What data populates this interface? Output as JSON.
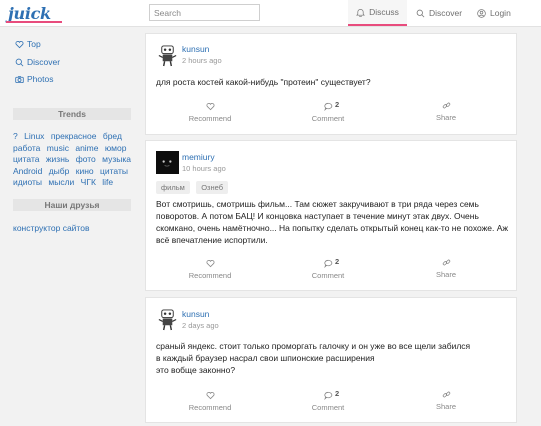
{
  "header": {
    "logo": "juick",
    "search_placeholder": "Search",
    "nav": [
      {
        "label": "Discuss",
        "icon": "bell-icon"
      },
      {
        "label": "Discover",
        "icon": "search-icon"
      },
      {
        "label": "Login",
        "icon": "user-icon"
      }
    ]
  },
  "sidebar": {
    "links": [
      {
        "label": "Top",
        "icon": "heart-icon"
      },
      {
        "label": "Discover",
        "icon": "search-icon"
      },
      {
        "label": "Photos",
        "icon": "camera-icon"
      }
    ],
    "trends_title": "Trends",
    "tags": [
      "?",
      "Linux",
      "прекрасное",
      "бред",
      "работа",
      "music",
      "anime",
      "юмор",
      "цитата",
      "жизнь",
      "фото",
      "музыка",
      "Android",
      "дыбр",
      "кино",
      "цитаты",
      "идиоты",
      "мысли",
      "ЧГК",
      "life"
    ],
    "friends_title": "Наши друзья",
    "friend_link": "конструктор сайтов"
  },
  "posts": [
    {
      "author": "kunsun",
      "time": "2 hours ago",
      "text": "для роста костей какой-нибудь \"протеин\" существует?",
      "tags": [],
      "recommend": "Recommend",
      "comment": "Comment",
      "comments": "2",
      "share": "Share"
    },
    {
      "author": "memiury",
      "time": "10 hours ago",
      "text": "Вот смотришь, смотришь фильм... Там сюжет закручивают в три ряда через семь поворотов. А потом БАЦ! И концовка наступает в течение минут этак двух. Очень скомкано, очень намётночно... На попытку сделать открытый конец как-то не похоже. Аж всё впечатление испортили.",
      "tags": [
        "фильм",
        "Ознеб"
      ],
      "recommend": "Recommend",
      "comment": "Comment",
      "comments": "2",
      "share": "Share"
    },
    {
      "author": "kunsun",
      "time": "2 days ago",
      "text_lines": [
        "сраный яндекс. стоит только проморгать галочку и он уже во все щели забился",
        "в каждый браузер насрал свои шпионские расширения",
        "это вобще законно?"
      ],
      "tags": [],
      "recommend": "Recommend",
      "comment": "Comment",
      "comments": "2",
      "share": "Share"
    }
  ],
  "colors": {
    "link": "#2e70b3",
    "accent": "#e84c7d"
  }
}
